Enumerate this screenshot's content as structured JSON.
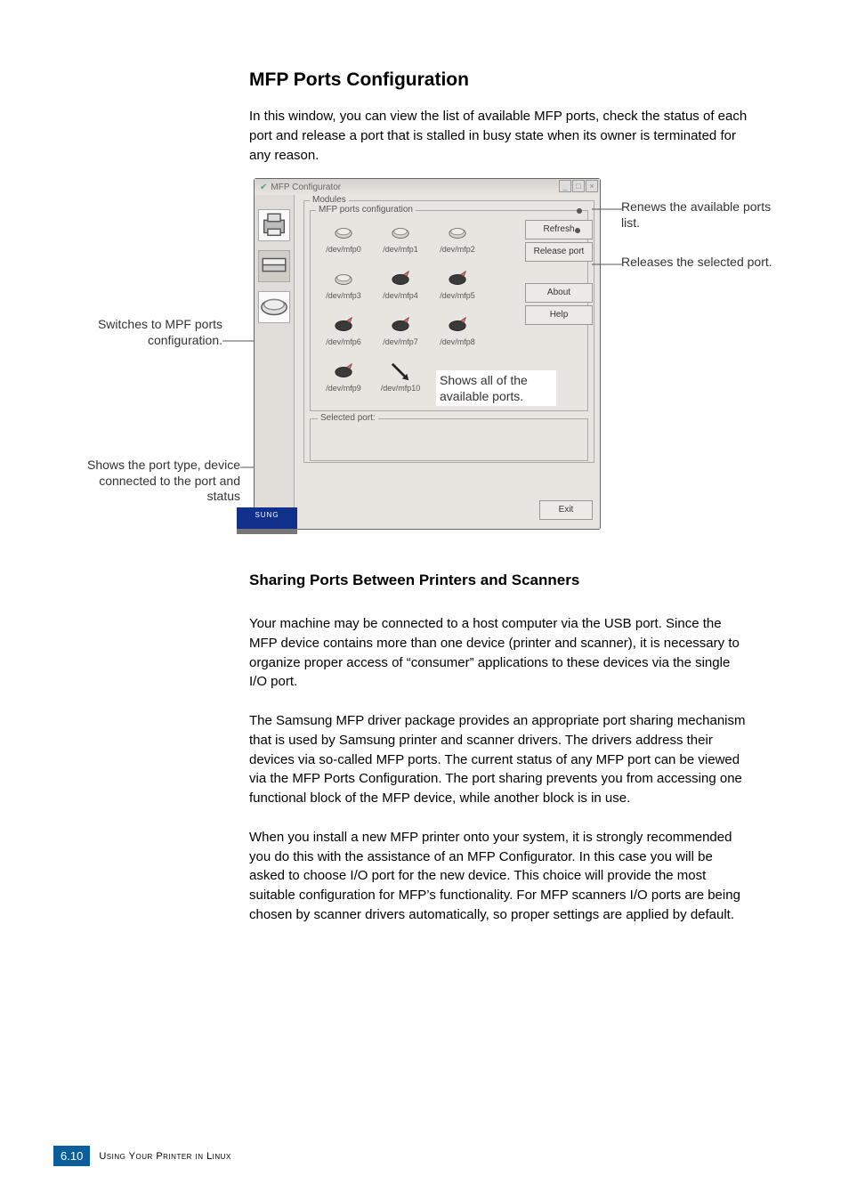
{
  "page": {
    "heading": "MFP Ports Configuration",
    "intro": "In this window, you can view the list of available MFP ports, check the status of each port and release a port that is stalled in busy state when its owner is terminated for any reason.",
    "heading2": "Sharing Ports Between Printers and Scanners",
    "p1": "Your machine may be connected to a host computer via the USB port. Since the MFP device contains more than one device (printer and scanner), it is necessary to organize proper access of “consumer” applications to these devices via the single I/O port.",
    "p2": "The Samsung MFP driver package provides an appropriate port sharing mechanism that is used by Samsung printer and scanner drivers. The drivers address their devices via so-called MFP ports. The current status of any MFP port can be viewed via the MFP Ports Configuration. The port sharing prevents you from accessing one functional block of the MFP device, while another block is in use.",
    "p3": "When you install a new MFP printer onto your system, it is strongly recommended you do this with the assistance of an MFP Configurator. In this case you will be asked to choose I/O port for the new device. This choice will provide the most suitable configuration for MFP’s functionality. For MFP scanners I/O ports are being chosen by scanner drivers automatically, so proper settings are applied by default."
  },
  "window": {
    "title": "MFP Configurator",
    "modules_label": "Modules",
    "panel_label": "MFP ports configuration",
    "selected_port_label": "Selected port:",
    "buttons": {
      "refresh": "Refresh",
      "release": "Release port",
      "about": "About",
      "help": "Help",
      "exit": "Exit"
    },
    "brand": "SUNG",
    "ports": [
      {
        "label": "/dev/mfp0",
        "kind": "free"
      },
      {
        "label": "/dev/mfp1",
        "kind": "free"
      },
      {
        "label": "/dev/mfp2",
        "kind": "free"
      },
      {
        "label": "/dev/mfp3",
        "kind": "free"
      },
      {
        "label": "/dev/mfp4",
        "kind": "busy"
      },
      {
        "label": "/dev/mfp5",
        "kind": "busy"
      },
      {
        "label": "/dev/mfp6",
        "kind": "busy"
      },
      {
        "label": "/dev/mfp7",
        "kind": "busy"
      },
      {
        "label": "/dev/mfp8",
        "kind": "busy"
      },
      {
        "label": "/dev/mfp9",
        "kind": "busy"
      },
      {
        "label": "/dev/mfp10",
        "kind": "arrow"
      }
    ]
  },
  "callouts": {
    "switch": "Switches to MPF ports configuration.",
    "available": "Shows all of the available ports.",
    "porttype": "Shows the port type, device connected to the port and status",
    "renews": "Renews the available ports list.",
    "releases": "Releases the selected port."
  },
  "footer": {
    "page": "6.10",
    "text": "Using Your Printer in Linux"
  }
}
